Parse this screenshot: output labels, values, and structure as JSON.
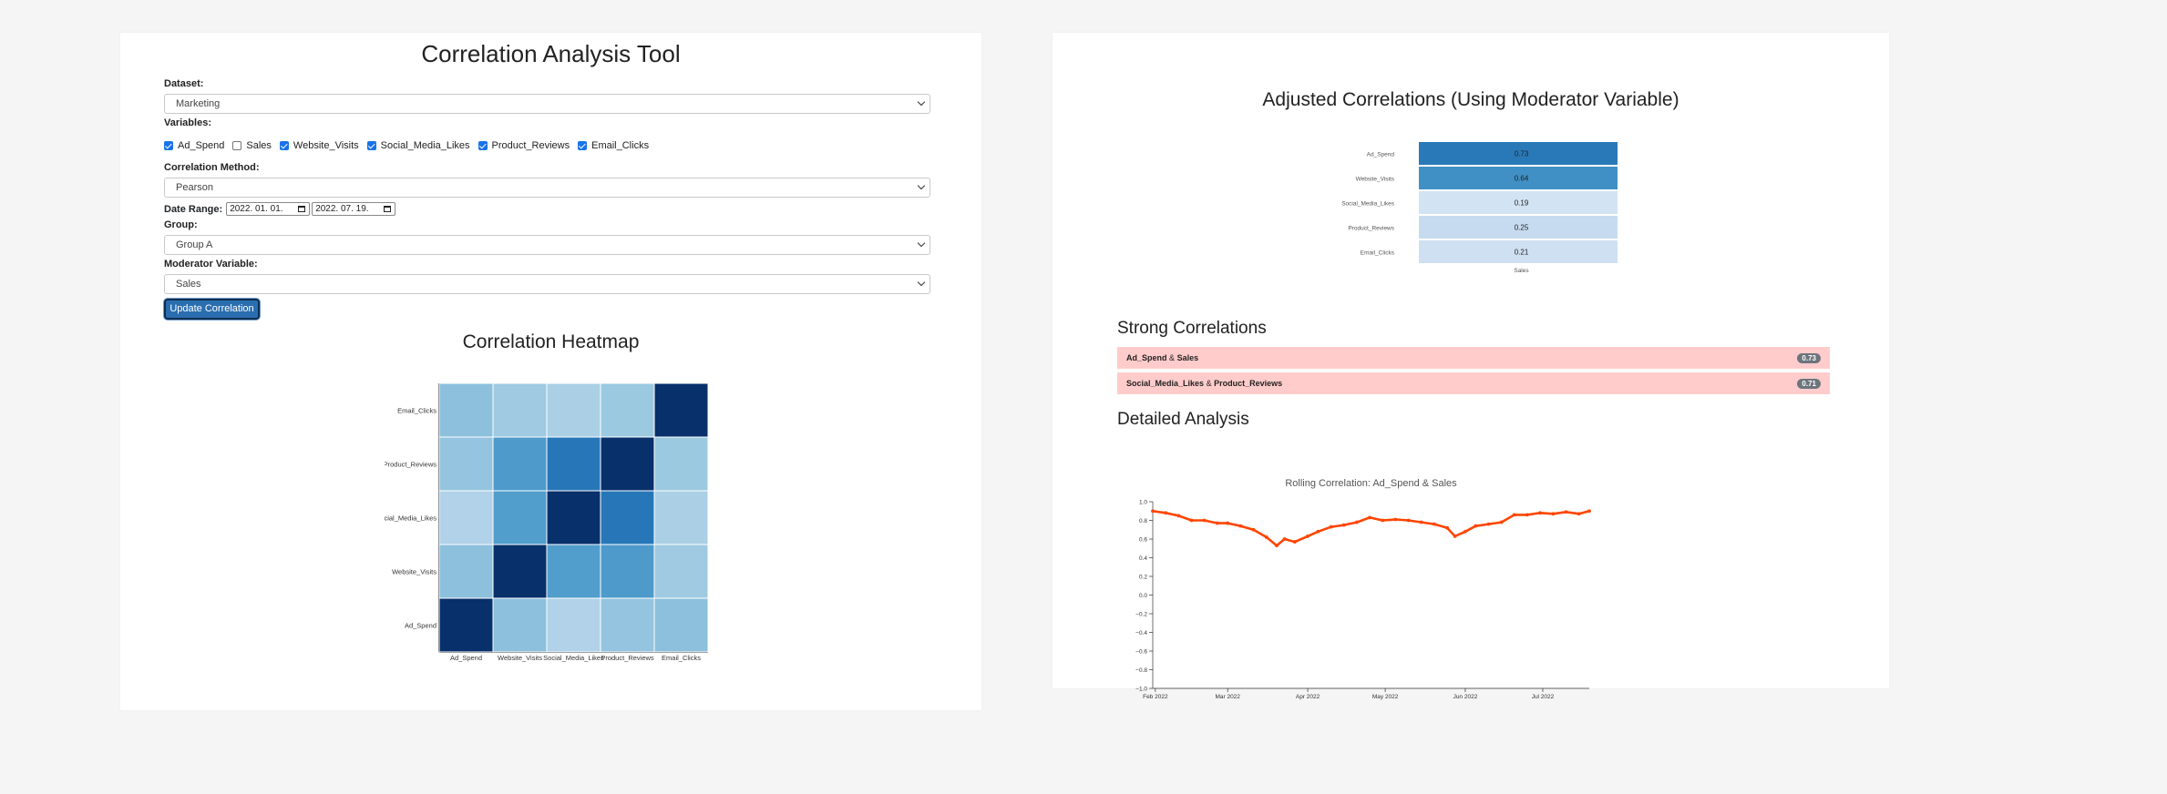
{
  "app": {
    "title": "Correlation Analysis Tool",
    "dataset_label": "Dataset:",
    "dataset_value": "Marketing",
    "variables_label": "Variables:",
    "variables": [
      {
        "label": "Ad_Spend",
        "checked": true
      },
      {
        "label": "Sales",
        "checked": false
      },
      {
        "label": "Website_Visits",
        "checked": true
      },
      {
        "label": "Social_Media_Likes",
        "checked": true
      },
      {
        "label": "Product_Reviews",
        "checked": true
      },
      {
        "label": "Email_Clicks",
        "checked": true
      }
    ],
    "method_label": "Correlation Method:",
    "method_value": "Pearson",
    "date_range_label": "Date Range:",
    "date_start": "2022. 01. 01.",
    "date_end": "2022. 07. 19.",
    "group_label": "Group:",
    "group_value": "Group A",
    "moderator_label": "Moderator Variable:",
    "moderator_value": "Sales",
    "update_button": "Update Correlation"
  },
  "heatmap": {
    "title": "Correlation Heatmap",
    "variables": [
      "Ad_Spend",
      "Website_Visits",
      "Social_Media_Likes",
      "Product_Reviews",
      "Email_Clicks"
    ],
    "matrix": [
      [
        1.0,
        0.38,
        0.27,
        0.36,
        0.38
      ],
      [
        0.38,
        1.0,
        0.55,
        0.56,
        0.33
      ],
      [
        0.27,
        0.55,
        1.0,
        0.71,
        0.29
      ],
      [
        0.36,
        0.56,
        0.71,
        1.0,
        0.34
      ],
      [
        0.38,
        0.33,
        0.29,
        0.34,
        1.0
      ]
    ]
  },
  "adjusted": {
    "title": "Adjusted Correlations (Using Moderator Variable)",
    "column_label": "Sales",
    "rows": [
      {
        "label": "Ad_Spend",
        "value": 0.73,
        "display": "0.73"
      },
      {
        "label": "Website_Visits",
        "value": 0.64,
        "display": "0.64"
      },
      {
        "label": "Social_Media_Likes",
        "value": 0.19,
        "display": "0.19"
      },
      {
        "label": "Product_Reviews",
        "value": 0.25,
        "display": "0.25"
      },
      {
        "label": "Email_Clicks",
        "value": 0.21,
        "display": "0.21"
      }
    ]
  },
  "strong": {
    "title": "Strong Correlations",
    "pairs": [
      {
        "a": "Ad_Spend",
        "joiner": "&",
        "b": "Sales",
        "badge": "0.73"
      },
      {
        "a": "Social_Media_Likes",
        "joiner": "&",
        "b": "Product_Reviews",
        "badge": "0.71"
      }
    ]
  },
  "detail": {
    "title": "Detailed Analysis"
  },
  "chart_data": {
    "type": "line",
    "title": "Rolling Correlation: Ad_Spend & Sales",
    "xlabel": "",
    "ylabel": "",
    "ylim": [
      -1.0,
      1.0
    ],
    "yticks": [
      "1.0",
      "0.8",
      "0.6",
      "0.4",
      "0.2",
      "0.0",
      "−0.2",
      "−0.4",
      "−0.6",
      "−0.8",
      "−1.0"
    ],
    "xticks": [
      "Feb 2022",
      "Mar 2022",
      "Apr 2022",
      "May 2022",
      "Jun 2022",
      "Jul 2022"
    ],
    "xtick_dates": [
      "2022-02-01",
      "2022-03-01",
      "2022-04-01",
      "2022-05-01",
      "2022-06-01",
      "2022-07-01"
    ],
    "x_start": "2022-01-31",
    "x_end": "2022-07-19",
    "line_color": "#ff4500",
    "series": [
      {
        "x": [
          "2022-01-31",
          "2022-02-05",
          "2022-02-10",
          "2022-02-15",
          "2022-02-20",
          "2022-02-25",
          "2022-03-01",
          "2022-03-06",
          "2022-03-11",
          "2022-03-16",
          "2022-03-20",
          "2022-03-23",
          "2022-03-27",
          "2022-04-01",
          "2022-04-05",
          "2022-04-10",
          "2022-04-15",
          "2022-04-20",
          "2022-04-25",
          "2022-04-30",
          "2022-05-05",
          "2022-05-10",
          "2022-05-15",
          "2022-05-20",
          "2022-05-25",
          "2022-05-28",
          "2022-06-01",
          "2022-06-05",
          "2022-06-10",
          "2022-06-15",
          "2022-06-20",
          "2022-06-25",
          "2022-06-30",
          "2022-07-05",
          "2022-07-10",
          "2022-07-15",
          "2022-07-19"
        ],
        "values": [
          0.9,
          0.88,
          0.85,
          0.8,
          0.8,
          0.77,
          0.77,
          0.74,
          0.7,
          0.62,
          0.53,
          0.6,
          0.57,
          0.63,
          0.68,
          0.73,
          0.75,
          0.78,
          0.83,
          0.8,
          0.81,
          0.8,
          0.78,
          0.76,
          0.72,
          0.63,
          0.68,
          0.74,
          0.76,
          0.78,
          0.86,
          0.86,
          0.88,
          0.87,
          0.89,
          0.87,
          0.9
        ]
      }
    ]
  }
}
